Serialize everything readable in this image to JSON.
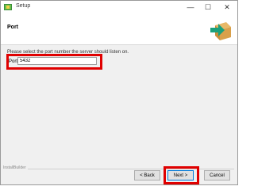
{
  "window": {
    "title": "Setup",
    "controls": {
      "minimize": "—",
      "maximize": "☐",
      "close": "✕"
    }
  },
  "header": {
    "title": "Port",
    "icon": "box-arrow-icon"
  },
  "main": {
    "instruction": "Please select the port number the server should listen on.",
    "port_label": "Port",
    "port_value": "5432"
  },
  "footer": {
    "brand": "InstallBuilder",
    "back_label": "< Back",
    "next_label": "Next >",
    "cancel_label": "Cancel"
  },
  "colors": {
    "highlight": "#e00000",
    "accent_arrow": "#1aa07c",
    "box": "#d9a04a"
  }
}
